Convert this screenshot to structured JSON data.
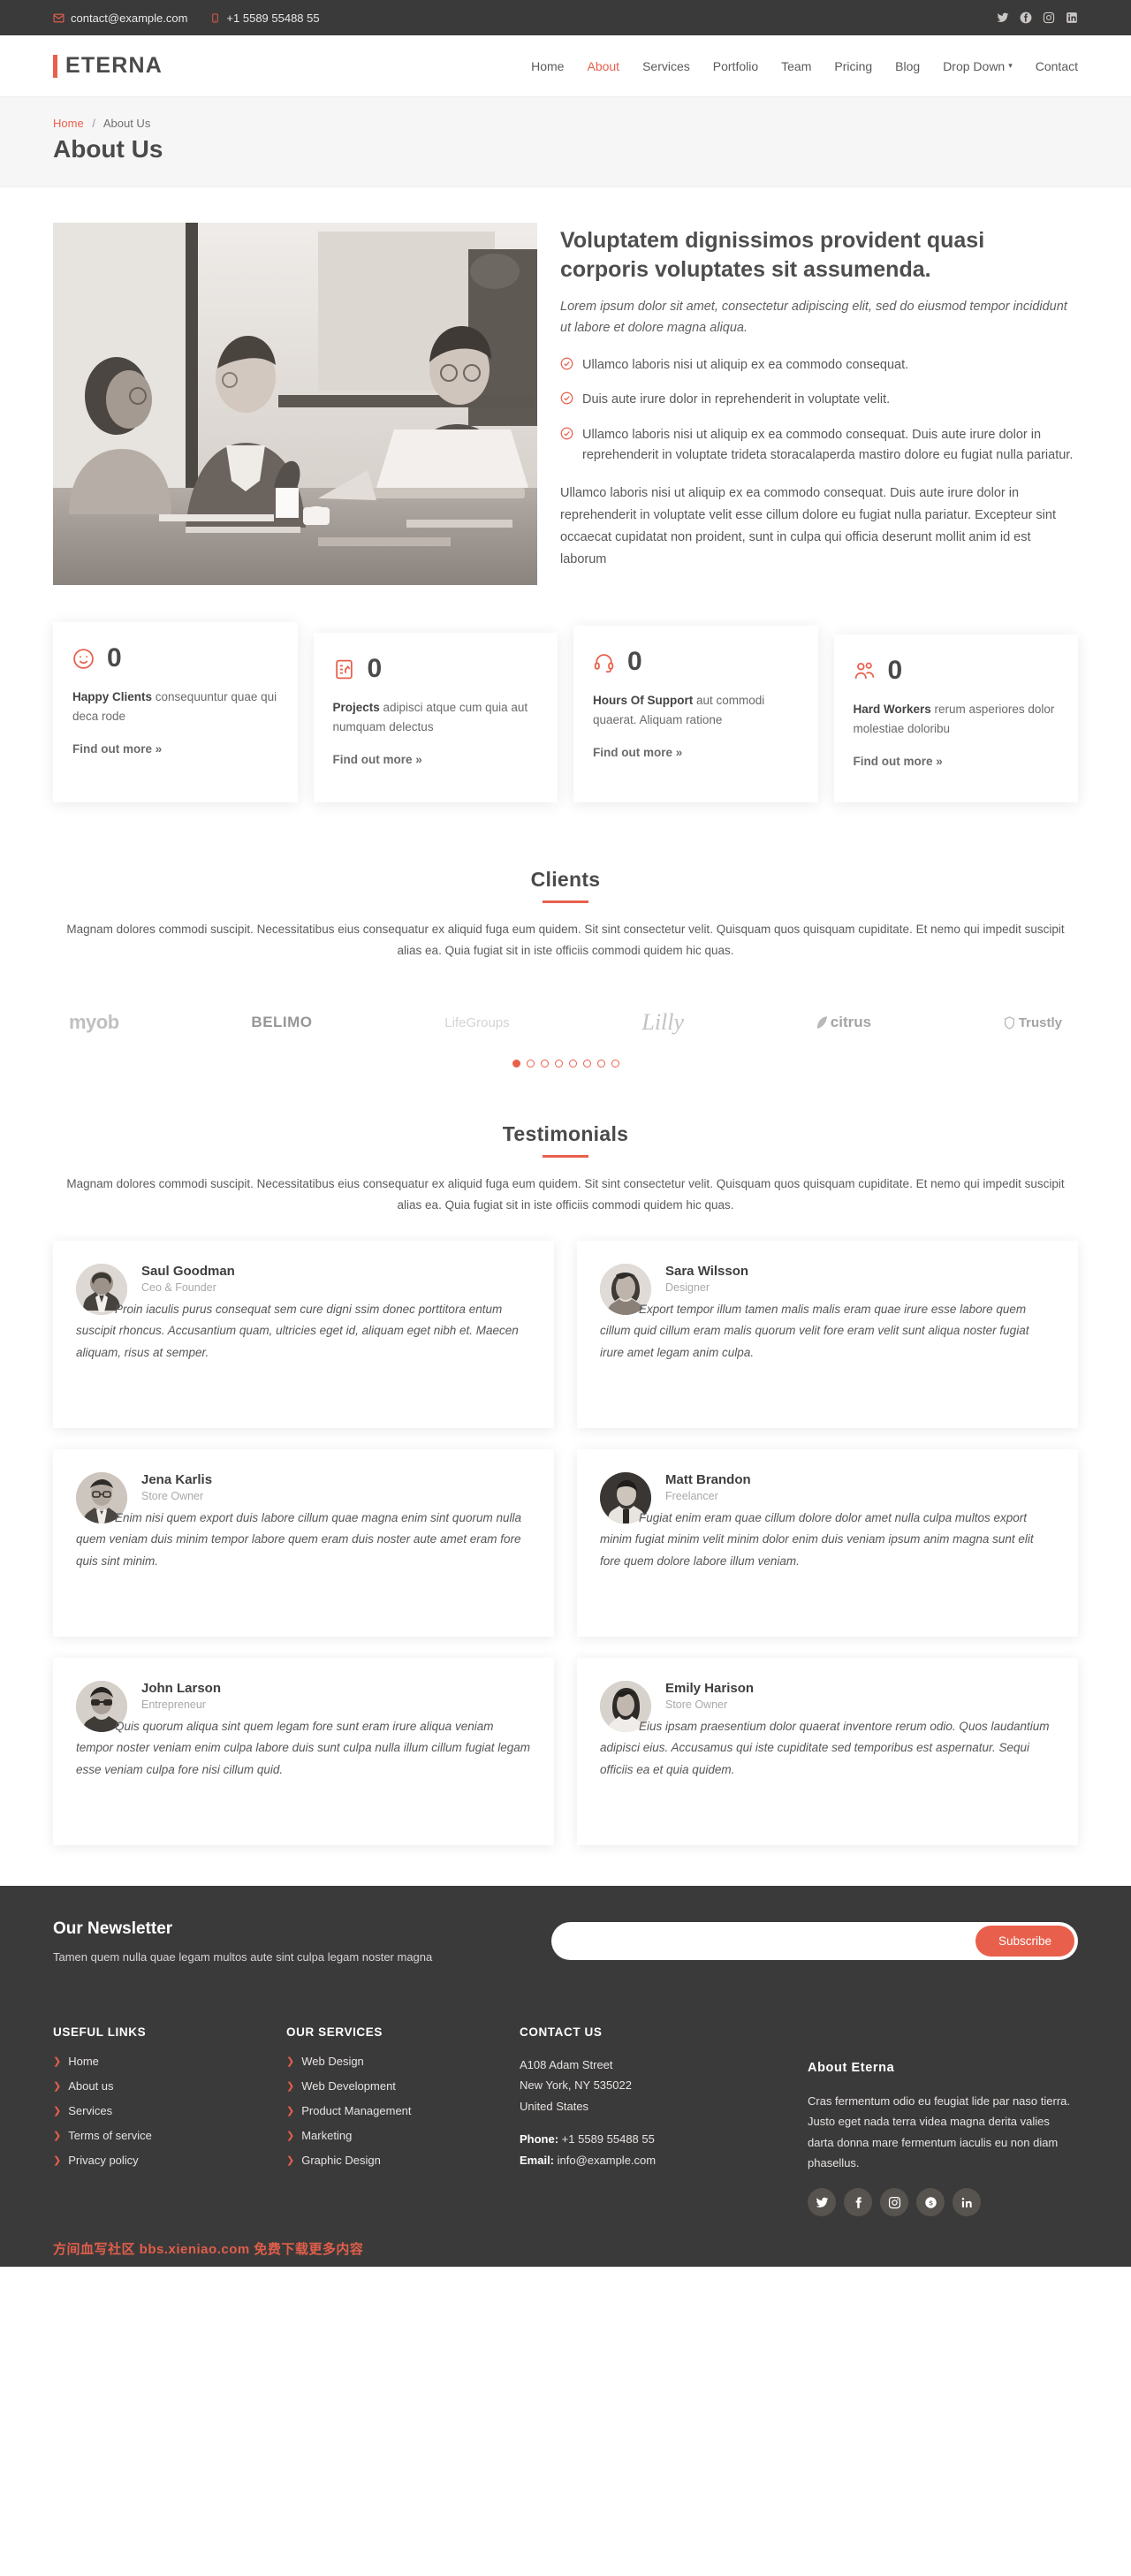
{
  "topbar": {
    "email": "contact@example.com",
    "phone": "+1 5589 55488 55",
    "email_icon": "envelope-icon",
    "phone_icon": "phone-icon",
    "social": [
      {
        "name": "twitter-icon",
        "label": "Twitter"
      },
      {
        "name": "facebook-icon",
        "label": "Facebook"
      },
      {
        "name": "instagram-icon",
        "label": "Instagram"
      },
      {
        "name": "linkedin-icon",
        "label": "LinkedIn"
      }
    ]
  },
  "header": {
    "logo": "ETERNA",
    "nav": [
      {
        "label": "Home",
        "active": false
      },
      {
        "label": "About",
        "active": true
      },
      {
        "label": "Services",
        "active": false
      },
      {
        "label": "Portfolio",
        "active": false
      },
      {
        "label": "Team",
        "active": false
      },
      {
        "label": "Pricing",
        "active": false
      },
      {
        "label": "Blog",
        "active": false
      },
      {
        "label": "Drop Down",
        "active": false,
        "caret": "⌄"
      },
      {
        "label": "Contact",
        "active": false
      }
    ]
  },
  "page": {
    "crumb_home": "Home",
    "crumb_sep": "/",
    "crumb_current": "About Us",
    "title": "About Us"
  },
  "about": {
    "heading": "Voluptatem dignissimos provident quasi corporis voluptates sit assumenda.",
    "lead": "Lorem ipsum dolor sit amet, consectetur adipiscing elit, sed do eiusmod tempor incididunt ut labore et dolore magna aliqua.",
    "checks": [
      "Ullamco laboris nisi ut aliquip ex ea commodo consequat.",
      "Duis aute irure dolor in reprehenderit in voluptate velit.",
      "Ullamco laboris nisi ut aliquip ex ea commodo consequat. Duis aute irure dolor in reprehenderit in voluptate trideta storacalaperda mastiro dolore eu fugiat nulla pariatur."
    ],
    "paragraph": "Ullamco laboris nisi ut aliquip ex ea commodo consequat. Duis aute irure dolor in reprehenderit in voluptate velit esse cillum dolore eu fugiat nulla pariatur. Excepteur sint occaecat cupidatat non proident, sunt in culpa qui officia deserunt mollit anim id est laborum",
    "image_alt": "team-meeting-photo"
  },
  "counters": [
    {
      "icon": "smiley-icon",
      "value": "0",
      "strong": "Happy Clients",
      "rest": " consequuntur quae qui deca rode",
      "link": "Find out more »"
    },
    {
      "icon": "document-chart-icon",
      "value": "0",
      "strong": "Projects",
      "rest": " adipisci atque cum quia aut numquam delectus",
      "link": "Find out more »"
    },
    {
      "icon": "headset-icon",
      "value": "0",
      "strong": "Hours Of Support",
      "rest": " aut commodi quaerat. Aliquam ratione",
      "link": "Find out more »"
    },
    {
      "icon": "users-icon",
      "value": "0",
      "strong": "Hard Workers",
      "rest": " rerum asperiores dolor molestiae doloribu",
      "link": "Find out more »"
    }
  ],
  "clients": {
    "title": "Clients",
    "subtitle": "Magnam dolores commodi suscipit. Necessitatibus eius consequatur ex aliquid fuga eum quidem. Sit sint consectetur velit. Quisquam quos quisquam cupiditate. Et nemo qui impedit suscipit alias ea. Quia fugiat sit in iste officiis commodi quidem hic quas.",
    "logos": [
      "myob",
      "BELIMO",
      "LifeGroups",
      "Lilly",
      "citrus",
      "Trustly"
    ],
    "dots_total": 8,
    "dots_active": 1
  },
  "testimonials": {
    "title": "Testimonials",
    "subtitle": "Magnam dolores commodi suscipit. Necessitatibus eius consequatur ex aliquid fuga eum quidem. Sit sint consectetur velit. Quisquam quos quisquam cupiditate. Et nemo qui impedit suscipit alias ea. Quia fugiat sit in iste officiis commodi quidem hic quas.",
    "items": [
      {
        "name": "Saul Goodman",
        "role": "Ceo & Founder",
        "quote": "Proin iaculis purus consequat sem cure digni ssim donec porttitora entum suscipit rhoncus. Accusantium quam, ultricies eget id, aliquam eget nibh et. Maecen aliquam, risus at semper.",
        "avatar": "avatar-saul-goodman"
      },
      {
        "name": "Sara Wilsson",
        "role": "Designer",
        "quote": "Export tempor illum tamen malis malis eram quae irure esse labore quem cillum quid cillum eram malis quorum velit fore eram velit sunt aliqua noster fugiat irure amet legam anim culpa.",
        "avatar": "avatar-sara-wilsson"
      },
      {
        "name": "Jena Karlis",
        "role": "Store Owner",
        "quote": "Enim nisi quem export duis labore cillum quae magna enim sint quorum nulla quem veniam duis minim tempor labore quem eram duis noster aute amet eram fore quis sint minim.",
        "avatar": "avatar-jena-karlis"
      },
      {
        "name": "Matt Brandon",
        "role": "Freelancer",
        "quote": "Fugiat enim eram quae cillum dolore dolor amet nulla culpa multos export minim fugiat minim velit minim dolor enim duis veniam ipsum anim magna sunt elit fore quem dolore labore illum veniam.",
        "avatar": "avatar-matt-brandon"
      },
      {
        "name": "John Larson",
        "role": "Entrepreneur",
        "quote": "Quis quorum aliqua sint quem legam fore sunt eram irure aliqua veniam tempor noster veniam enim culpa labore duis sunt culpa nulla illum cillum fugiat legam esse veniam culpa fore nisi cillum quid.",
        "avatar": "avatar-john-larson"
      },
      {
        "name": "Emily Harison",
        "role": "Store Owner",
        "quote": "Eius ipsam praesentium dolor quaerat inventore rerum odio. Quos laudantium adipisci eius. Accusamus qui iste cupiditate sed temporibus est aspernatur. Sequi officiis ea et quia quidem.",
        "avatar": "avatar-emily-harison"
      }
    ]
  },
  "newsletter": {
    "heading": "Our Newsletter",
    "text": "Tamen quem nulla quae legam multos aute sint culpa legam noster magna",
    "input_value": "",
    "input_placeholder": "",
    "button": "Subscribe"
  },
  "footer": {
    "links_title": "USEFUL LINKS",
    "links": [
      "Home",
      "About us",
      "Services",
      "Terms of service",
      "Privacy policy"
    ],
    "services_title": "OUR SERVICES",
    "services": [
      "Web Design",
      "Web Development",
      "Product Management",
      "Marketing",
      "Graphic Design"
    ],
    "contact_title": "CONTACT US",
    "address_line1": "A108 Adam Street",
    "address_line2": "New York, NY 535022",
    "address_line3": "United States",
    "phone_label": "Phone:",
    "phone_value": " +1 5589 55488 55",
    "email_label": "Email:",
    "email_value": " info@example.com",
    "about_title": "About Eterna",
    "about_text": "Cras fermentum odio eu feugiat lide par naso tierra. Justo eget nada terra videa magna derita valies darta donna mare fermentum iaculis eu non diam phasellus.",
    "social": [
      {
        "name": "twitter-icon"
      },
      {
        "name": "facebook-icon"
      },
      {
        "name": "instagram-icon"
      },
      {
        "name": "skype-icon"
      },
      {
        "name": "linkedin-icon"
      }
    ],
    "watermark": "方间血写社区 bbs.xieniao.com 免费下载更多内容"
  },
  "colors": {
    "accent": "#e8604c",
    "dark": "#3b3a3a",
    "text": "#585858"
  }
}
